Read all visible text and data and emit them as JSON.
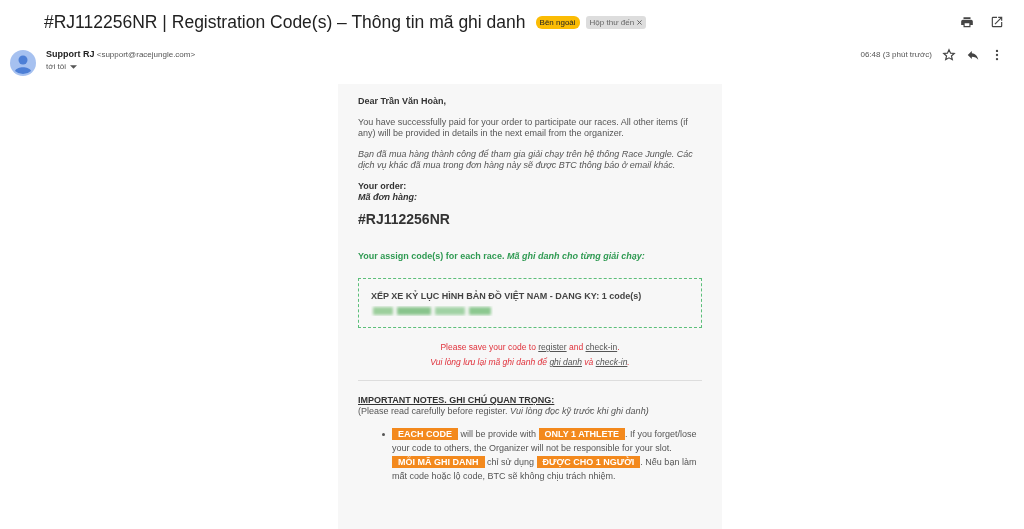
{
  "subject": "#RJ112256NR | Registration Code(s) – Thông tin mã ghi danh",
  "labels": [
    {
      "text": "Bên ngoài",
      "kind": "external"
    },
    {
      "text": "Hộp thư đến",
      "kind": "inbox",
      "removable": true
    }
  ],
  "sender": {
    "name": "Support RJ",
    "email": "<support@racejungle.com>",
    "to": "tới tôi",
    "time": "06:48 (3 phút trước)",
    "starred": false
  },
  "email": {
    "greeting": "Dear Trần Văn Hoàn,",
    "intro": "You have successfully paid for your order to participate our races. All other items (if any) will be provided in details in the next email from the organizer.",
    "intro_vi": "Bạn đã mua hàng thành công để tham gia giải chạy trên hệ thống Race Jungle. Các dịch vụ khác đã mua trong đơn hàng này sẽ được BTC thông báo ở email khác.",
    "order_label": "Your order:",
    "order_label_vi": "Mã đơn hàng:",
    "order_code": "#RJ112256NR",
    "assign": "Your assign code(s) for each race. *Mã ghi danh cho từng giải chạy:*",
    "race": "XẾP XE KỶ LỤC HÌNH BẢN ĐỒ VIỆT NAM - DANG KY: 1 code(s)",
    "save_en": [
      {
        "kind": "text",
        "text": "Please save your code to "
      },
      {
        "kind": "link",
        "text": "register"
      },
      {
        "kind": "text",
        "text": " and "
      },
      {
        "kind": "link",
        "text": "check-in"
      },
      {
        "kind": "text",
        "text": "."
      }
    ],
    "save_vi": [
      {
        "kind": "text",
        "text": "Vui lòng lưu lại mã ghi danh để "
      },
      {
        "kind": "link",
        "text": "ghi danh"
      },
      {
        "kind": "text",
        "text": " và "
      },
      {
        "kind": "link",
        "text": "check-in"
      },
      {
        "kind": "text",
        "text": "."
      }
    ],
    "notes_title": "IMPORTANT NOTES. GHI CHÚ QUAN TRỌNG:",
    "notes_sub": "(Please read carefully before register. *Vui lòng đọc kỹ trước khi ghi danh)*",
    "notes": [
      [
        {
          "kind": "tag",
          "text": "EACH CODE"
        },
        {
          "kind": "text",
          "text": " will be provide with "
        },
        {
          "kind": "tag",
          "text": "ONLY 1 ATHLETE"
        },
        {
          "kind": "text",
          "text": ". If you forget/lose your code to others, the Organizer will not be responsible for your slot. "
        },
        {
          "kind": "tag",
          "text": "MỖI MÃ GHI DANH"
        },
        {
          "kind": "text",
          "text": " chỉ sử dụng "
        },
        {
          "kind": "tag",
          "text": "ĐƯỢC CHO 1 NGƯỜI"
        },
        {
          "kind": "text",
          "text": ". Nếu bạn làm mất code hoặc lộ code, BTC sẽ không chịu trách nhiệm."
        }
      ]
    ]
  }
}
